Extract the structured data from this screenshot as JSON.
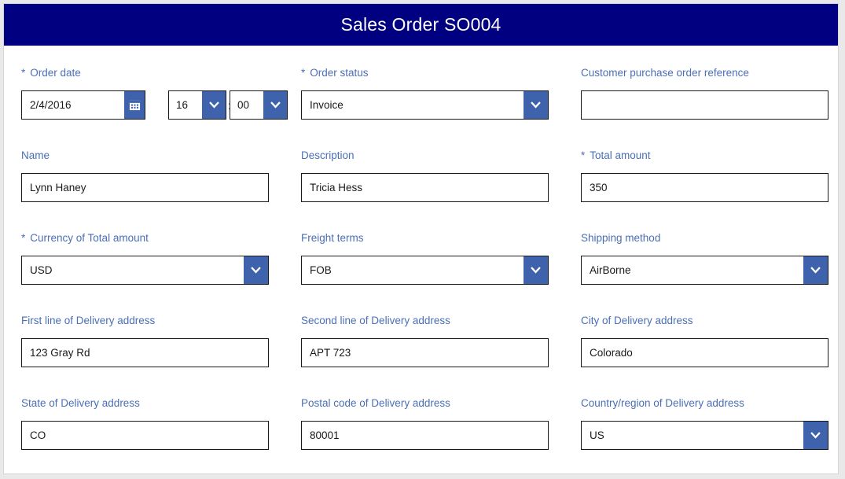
{
  "header": {
    "title": "Sales Order SO004",
    "background_color": "#000080",
    "text_color": "#ffffff"
  },
  "theme": {
    "label_color": "#4a6fb5",
    "control_accent": "#3f62ad",
    "border_color": "#1a1a1a",
    "page_background": "#e9e9ea",
    "card_background": "#ffffff"
  },
  "form": {
    "required_marker": "*",
    "time_separator": ":",
    "rows": [
      {
        "fields": [
          {
            "name": "order-date",
            "label": "Order date",
            "required": true,
            "type": "datetime",
            "value": "2/4/2016",
            "hour": "16",
            "minute": "00",
            "icon": "calendar-icon"
          },
          {
            "name": "order-status",
            "label": "Order status",
            "required": true,
            "type": "select",
            "value": "Invoice"
          },
          {
            "name": "customer-purchase-order-reference",
            "label": "Customer purchase order reference",
            "required": false,
            "type": "text",
            "value": ""
          }
        ]
      },
      {
        "fields": [
          {
            "name": "name",
            "label": "Name",
            "required": false,
            "type": "text",
            "value": "Lynn Haney"
          },
          {
            "name": "description",
            "label": "Description",
            "required": false,
            "type": "text",
            "value": "Tricia Hess"
          },
          {
            "name": "total-amount",
            "label": "Total amount",
            "required": true,
            "type": "text",
            "value": "350"
          }
        ]
      },
      {
        "fields": [
          {
            "name": "currency-of-total-amount",
            "label": "Currency of Total amount",
            "required": true,
            "type": "select",
            "value": "USD"
          },
          {
            "name": "freight-terms",
            "label": "Freight terms",
            "required": false,
            "type": "select",
            "value": "FOB"
          },
          {
            "name": "shipping-method",
            "label": "Shipping method",
            "required": false,
            "type": "select",
            "value": "AirBorne"
          }
        ]
      },
      {
        "fields": [
          {
            "name": "first-line-of-delivery-address",
            "label": "First line of Delivery address",
            "required": false,
            "type": "text",
            "value": "123 Gray Rd"
          },
          {
            "name": "second-line-of-delivery-address",
            "label": "Second line of Delivery address",
            "required": false,
            "type": "text",
            "value": "APT 723"
          },
          {
            "name": "city-of-delivery-address",
            "label": "City of Delivery address",
            "required": false,
            "type": "text",
            "value": "Colorado"
          }
        ]
      },
      {
        "fields": [
          {
            "name": "state-of-delivery-address",
            "label": "State of Delivery address",
            "required": false,
            "type": "text",
            "value": "CO"
          },
          {
            "name": "postal-code-of-delivery-address",
            "label": "Postal code of Delivery address",
            "required": false,
            "type": "text",
            "value": "80001"
          },
          {
            "name": "country-region-of-delivery-address",
            "label": "Country/region of Delivery address",
            "required": false,
            "type": "select",
            "value": "US"
          }
        ]
      }
    ]
  }
}
